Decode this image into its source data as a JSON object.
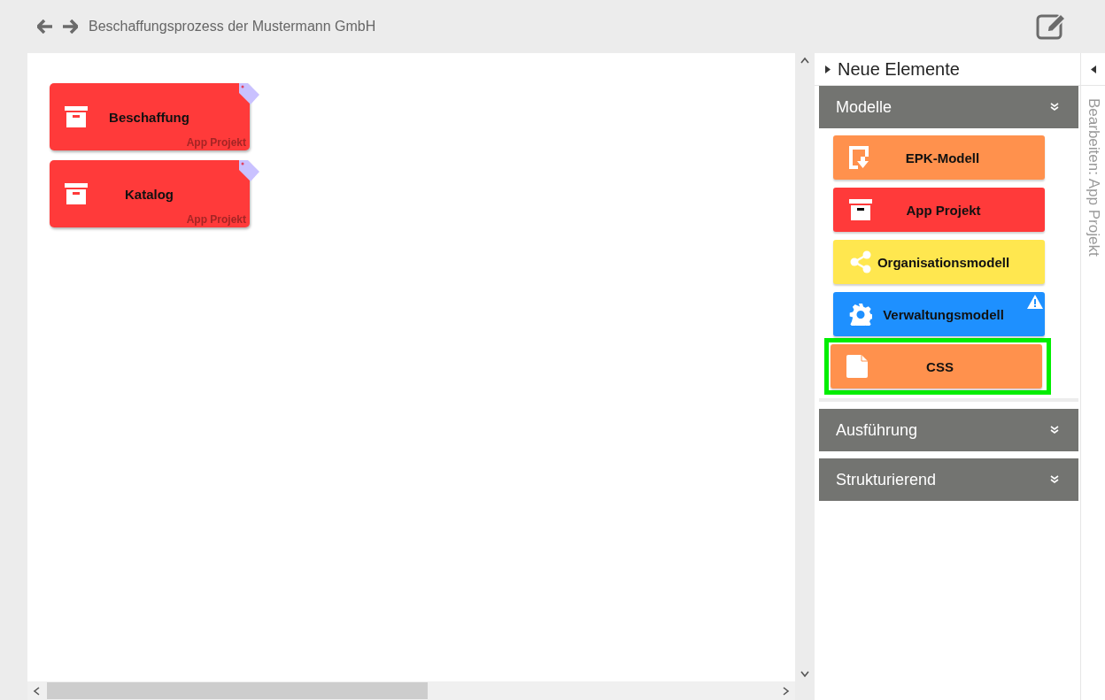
{
  "header": {
    "title": "Beschaffungsprozess der Mustermann GmbH"
  },
  "canvas": {
    "nodes": [
      {
        "label": "Beschaffung",
        "type": "App Projekt",
        "color": "#ff3a3a"
      },
      {
        "label": "Katalog",
        "type": "App Projekt",
        "color": "#ff3a3a"
      }
    ]
  },
  "sidebar": {
    "title": "Neue Elemente",
    "expanded": false,
    "sections": [
      {
        "title": "Modelle",
        "items": [
          {
            "label": "EPK-Modell",
            "kind": "epk",
            "color": "#ff914d",
            "warning": false,
            "highlighted": false
          },
          {
            "label": "App Projekt",
            "kind": "archive",
            "color": "#ff3a3a",
            "warning": false,
            "highlighted": false
          },
          {
            "label": "Organisationsmodell",
            "kind": "share",
            "color": "#ffe74f",
            "warning": false,
            "highlighted": false
          },
          {
            "label": "Verwaltungsmodell",
            "kind": "gear",
            "color": "#1e90ff",
            "warning": true,
            "highlighted": false
          },
          {
            "label": "CSS",
            "kind": "file",
            "color": "#ff914d",
            "warning": false,
            "highlighted": true
          }
        ]
      },
      {
        "title": "Ausführung"
      },
      {
        "title": "Strukturierend"
      }
    ]
  },
  "side_tab": {
    "label": "Bearbeiten: App Projekt"
  }
}
